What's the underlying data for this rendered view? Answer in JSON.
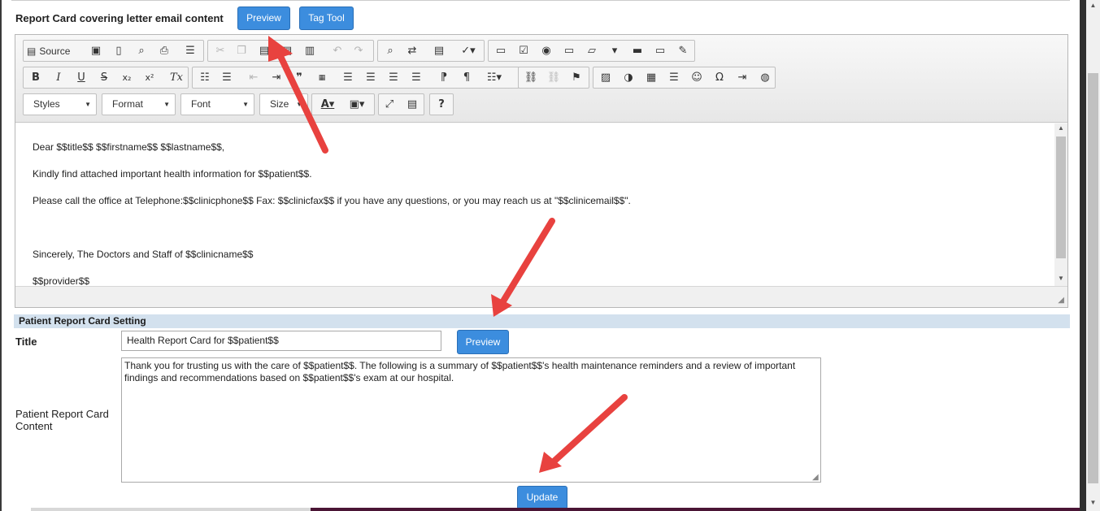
{
  "header": {
    "section_title": "Report Card covering letter email content",
    "preview_button": "Preview",
    "tag_tool_button": "Tag Tool"
  },
  "editor": {
    "toolbar": {
      "source_label": "Source",
      "combos": {
        "styles": "Styles",
        "format": "Format",
        "font": "Font",
        "size": "Size"
      },
      "formatting_glyphs": {
        "bold": "B",
        "italic": "I",
        "underline": "U",
        "strike": "S",
        "subscript": "x₂",
        "superscript": "x²",
        "remove_format": "Tx",
        "blockquote": "❞",
        "help": "?"
      }
    },
    "content_lines": [
      " Dear $$title$$ $$firstname$$ $$lastname$$,",
      "Kindly find attached important health information for $$patient$$.",
      "Please call the office at Telephone:$$clinicphone$$ Fax: $$clinicfax$$ if you have any questions, or you may reach us at \"$$clinicemail$$\".",
      "Sincerely, The Doctors and Staff of $$clinicname$$",
      "$$provider$$"
    ]
  },
  "settings": {
    "section_title": "Patient Report Card Setting",
    "title_label": "Title",
    "title_value": "Health Report Card for $$patient$$",
    "preview_button": "Preview",
    "content_label_line1": "Patient Report Card",
    "content_label_line2": "Content",
    "content_value": "Thank you for trusting us with the care of  $$patient$$. The following is a summary of  $$patient$$'s health maintenance reminders and a review of important findings and recommendations based on  $$patient$$'s exam at our hospital.",
    "update_button": "Update"
  },
  "colors": {
    "primary_button": "#3c8dde",
    "section_bar": "#d3e1ee",
    "annotation_arrow": "#e8423f"
  }
}
